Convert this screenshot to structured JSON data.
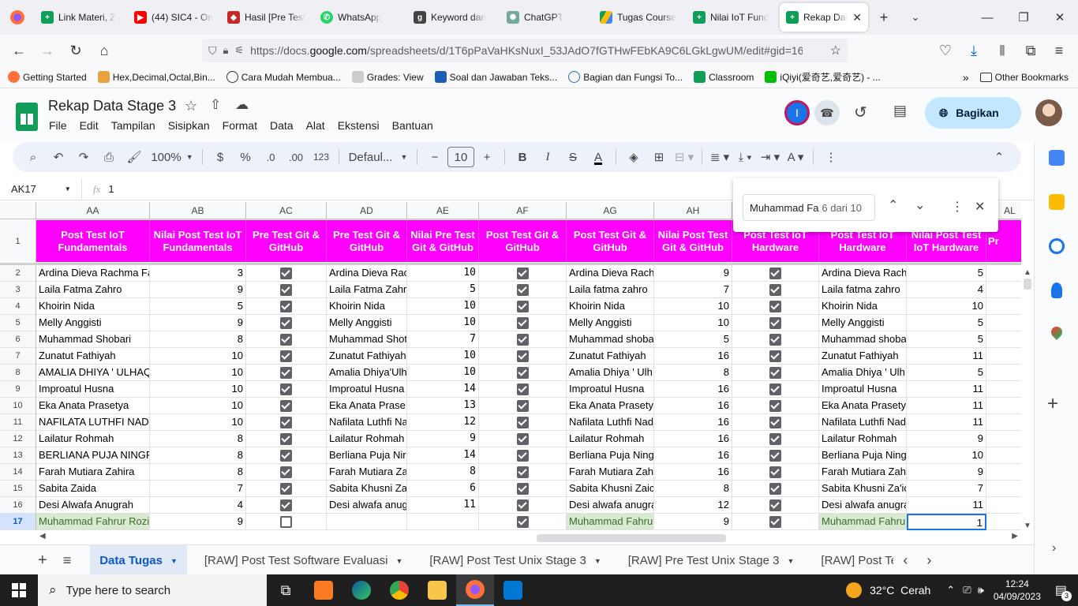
{
  "browser": {
    "tabs": [
      {
        "label": "Link Materi, Z",
        "icon_color": "#0f9d58"
      },
      {
        "label": "(44) SIC4 - On",
        "icon_color": "#ff0000"
      },
      {
        "label": "Hasil [Pre Test",
        "icon_color": "#c62828"
      },
      {
        "label": "WhatsApp",
        "icon_color": "#25d366"
      },
      {
        "label": "Keyword dan",
        "icon_color": "#444"
      },
      {
        "label": "ChatGPT",
        "icon_color": "#74aa9c"
      },
      {
        "label": "Tugas Course",
        "icon_color": "#fbbc04"
      },
      {
        "label": "Nilai IoT Fund",
        "icon_color": "#0f9d58"
      },
      {
        "label": "Rekap Data",
        "icon_color": "#0f9d58"
      }
    ],
    "url_prefix": "https://docs.",
    "url_domain": "google.com",
    "url_rest": "/spreadsheets/d/1T6pPaVaHKsNuxI_53JAdO7fGTHwFEbKA9C6LGkLgwUM/edit#gid=164",
    "bookmarks": [
      "Getting Started",
      "Hex,Decimal,Octal,Bin...",
      "Cara Mudah Membua...",
      "Grades: View",
      "Soal dan Jawaban Teks...",
      "Bagian dan Fungsi To...",
      "Classroom",
      "iQiyi(爱奇艺,爱奇艺) - ..."
    ],
    "other_bookmarks": "Other Bookmarks"
  },
  "sheets": {
    "title": "Rekap Data Stage 3",
    "menu": [
      "File",
      "Edit",
      "Tampilan",
      "Sisipkan",
      "Format",
      "Data",
      "Alat",
      "Ekstensi",
      "Bantuan"
    ],
    "share_label": "Bagikan",
    "avatar_letter": "I",
    "toolbar": {
      "zoom": "100%",
      "currency": "$",
      "percent": "%",
      "dec_minus": ".0",
      "dec_plus": ".00",
      "number_fmt": "123",
      "font": "Defaul...",
      "font_size": "10"
    },
    "cell_ref": "AK17",
    "formula_value": "1",
    "find": {
      "query": "Muhammad Fa",
      "count": "6 dari 10"
    },
    "columns": [
      "AA",
      "AB",
      "AC",
      "AD",
      "AE",
      "AF",
      "AG",
      "AH",
      "AI",
      "AJ",
      "AK",
      "AL"
    ],
    "headers": [
      "Post Test IoT Fundamentals",
      "Nilai Post Test IoT Fundamentals",
      "Pre Test Git & GitHub",
      "Pre Test Git & GitHub",
      "Nilai Pre Test Git & GitHub",
      "Post Test Git & GitHub",
      "Post Test Git & GitHub",
      "Nilai Post Test Git & GitHub",
      "Post Test IoT Hardware",
      "Post Test IoT Hardware",
      "Nilai Post Test IoT Hardware",
      "Pr"
    ],
    "rows": [
      {
        "n": "2",
        "aa": "Ardina Dieva Rachma Fa",
        "ab": "3",
        "ac": true,
        "ad": "Ardina Dieva Rac",
        "ae": "10",
        "af": true,
        "ag": "Ardina Dieva Rach",
        "ah": "9",
        "ai": true,
        "aj": "Ardina Dieva Rach",
        "ak": "5"
      },
      {
        "n": "3",
        "aa": "Laila Fatma Zahro",
        "ab": "9",
        "ac": true,
        "ad": "Laila Fatma Zahr",
        "ae": "5",
        "af": true,
        "ag": "Laila fatma zahro",
        "ah": "7",
        "ai": true,
        "aj": "Laila fatma zahro",
        "ak": "4"
      },
      {
        "n": "4",
        "aa": "Khoirin Nida",
        "ab": "5",
        "ac": true,
        "ad": "Khoirin Nida",
        "ae": "10",
        "af": true,
        "ag": "Khoirin Nida",
        "ah": "10",
        "ai": true,
        "aj": "Khoirin Nida",
        "ak": "10"
      },
      {
        "n": "5",
        "aa": "Melly Anggisti",
        "ab": "9",
        "ac": true,
        "ad": "Melly Anggisti",
        "ae": "10",
        "af": true,
        "ag": "Melly Anggisti",
        "ah": "10",
        "ai": true,
        "aj": "Melly Anggisti",
        "ak": "5"
      },
      {
        "n": "6",
        "aa": "Muhammad Shobari",
        "ab": "8",
        "ac": true,
        "ad": "Muhammad Shot",
        "ae": "7",
        "af": true,
        "ag": "Muhammad shoba",
        "ah": "5",
        "ai": true,
        "aj": "Muhammad shoba",
        "ak": "5"
      },
      {
        "n": "7",
        "aa": "Zunatut Fathiyah",
        "ab": "10",
        "ac": true,
        "ad": "Zunatut Fathiyah",
        "ae": "10",
        "af": true,
        "ag": "Zunatut Fathiyah",
        "ah": "16",
        "ai": true,
        "aj": "Zunatut Fathiyah",
        "ak": "11"
      },
      {
        "n": "8",
        "aa": "AMALIA DHIYA ' ULHAQ",
        "ab": "10",
        "ac": true,
        "ad": "Amalia Dhiya'Ulh",
        "ae": "10",
        "af": true,
        "ag": "Amalia Dhiya ' Ulh",
        "ah": "8",
        "ai": true,
        "aj": "Amalia Dhiya ' Ulh",
        "ak": "5"
      },
      {
        "n": "9",
        "aa": "Improatul Husna",
        "ab": "10",
        "ac": true,
        "ad": "Improatul Husna",
        "ae": "14",
        "af": true,
        "ag": "Improatul Husna",
        "ah": "16",
        "ai": true,
        "aj": "Improatul Husna",
        "ak": "11"
      },
      {
        "n": "10",
        "aa": "Eka Anata Prasetya",
        "ab": "10",
        "ac": true,
        "ad": "Eka Anata Prase",
        "ae": "13",
        "af": true,
        "ag": "Eka Anata Prasety",
        "ah": "16",
        "ai": true,
        "aj": "Eka Anata Prasety",
        "ak": "11"
      },
      {
        "n": "11",
        "aa": "NAFILATA LUTHFI NADJ",
        "ab": "10",
        "ac": true,
        "ad": "Nafilata Luthfi Na",
        "ae": "12",
        "af": true,
        "ag": "Nafilata Luthfi Nadj",
        "ah": "16",
        "ai": true,
        "aj": "Nafilata Luthfi Nadj",
        "ak": "11"
      },
      {
        "n": "12",
        "aa": "Lailatur Rohmah",
        "ab": "8",
        "ac": true,
        "ad": "Lailatur Rohmah",
        "ae": "9",
        "af": true,
        "ag": "Lailatur Rohmah",
        "ah": "16",
        "ai": true,
        "aj": "Lailatur Rohmah",
        "ak": "9"
      },
      {
        "n": "13",
        "aa": "BERLIANA PUJA NINGR",
        "ab": "8",
        "ac": true,
        "ad": "Berliana Puja Nir",
        "ae": "14",
        "af": true,
        "ag": "Berliana Puja Ning",
        "ah": "16",
        "ai": true,
        "aj": "Berliana Puja Ning",
        "ak": "10"
      },
      {
        "n": "14",
        "aa": "Farah Mutiara Zahira",
        "ab": "8",
        "ac": true,
        "ad": "Farah Mutiara Za",
        "ae": "8",
        "af": true,
        "ag": "Farah Mutiara Zahi",
        "ah": "16",
        "ai": true,
        "aj": "Farah Mutiara Zahi",
        "ak": "9"
      },
      {
        "n": "15",
        "aa": "Sabita Zaida",
        "ab": "7",
        "ac": true,
        "ad": "Sabita Khusni Za",
        "ae": "6",
        "af": true,
        "ag": "Sabita Khusni Zaic",
        "ah": "8",
        "ai": true,
        "aj": "Sabita Khusni Za'ic",
        "ak": "7"
      },
      {
        "n": "16",
        "aa": "Desi Alwafa Anugrah",
        "ab": "4",
        "ac": true,
        "ad": "Desi alwafa anug",
        "ae": "11",
        "af": true,
        "ag": "Desi alwafa anugra",
        "ah": "12",
        "ai": true,
        "aj": "Desi alwafa anugra",
        "ak": "11"
      },
      {
        "n": "17",
        "aa": "Muhammad Fahrur Rozi",
        "ab": "9",
        "ac": false,
        "ad": "",
        "ae": "",
        "af": true,
        "ag": "Muhammad Fahrur",
        "ah": "9",
        "ai": true,
        "aj": "Muhammad Fahrur",
        "ak": "1"
      }
    ],
    "sheet_tabs": [
      "Data Tugas",
      "[RAW] Post Test Software Evaluasi",
      "[RAW] Post Test Unix Stage 3",
      "[RAW] Pre Test Unix Stage 3",
      "[RAW] Post Te"
    ]
  },
  "taskbar": {
    "search_placeholder": "Type here to search",
    "weather": "32°C  Cerah",
    "time": "12:24",
    "date": "04/09/2023",
    "notif_count": "3"
  }
}
